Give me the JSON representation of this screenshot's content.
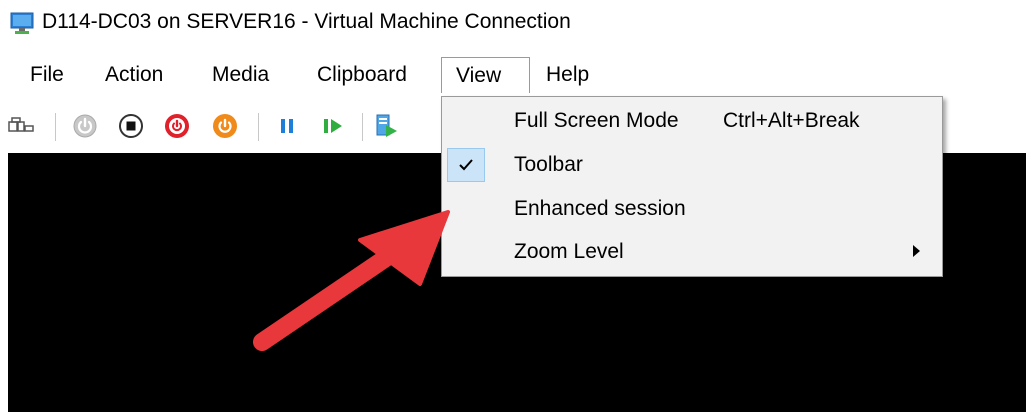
{
  "window": {
    "title": "D114-DC03 on SERVER16 - Virtual Machine Connection",
    "icon": "vm-connection-icon"
  },
  "menubar": {
    "items": [
      {
        "label": "File"
      },
      {
        "label": "Action"
      },
      {
        "label": "Media"
      },
      {
        "label": "Clipboard"
      },
      {
        "label": "View",
        "active": true
      },
      {
        "label": "Help"
      }
    ]
  },
  "toolbar": {
    "buttons": [
      {
        "name": "ctrl-alt-del-icon"
      },
      {
        "name": "start-icon"
      },
      {
        "name": "turn-off-icon"
      },
      {
        "name": "shutdown-icon"
      },
      {
        "name": "save-icon"
      },
      {
        "name": "pause-icon"
      },
      {
        "name": "resume-icon"
      },
      {
        "name": "checkpoint-icon"
      }
    ]
  },
  "view_menu": {
    "items": [
      {
        "label": "Full Screen Mode",
        "shortcut": "Ctrl+Alt+Break",
        "checked": false
      },
      {
        "label": "Toolbar",
        "checked": true
      },
      {
        "label": "Enhanced session",
        "checked": false
      },
      {
        "label": "Zoom Level",
        "has_submenu": true
      }
    ]
  },
  "annotation": {
    "arrow_color": "#e8383c"
  }
}
